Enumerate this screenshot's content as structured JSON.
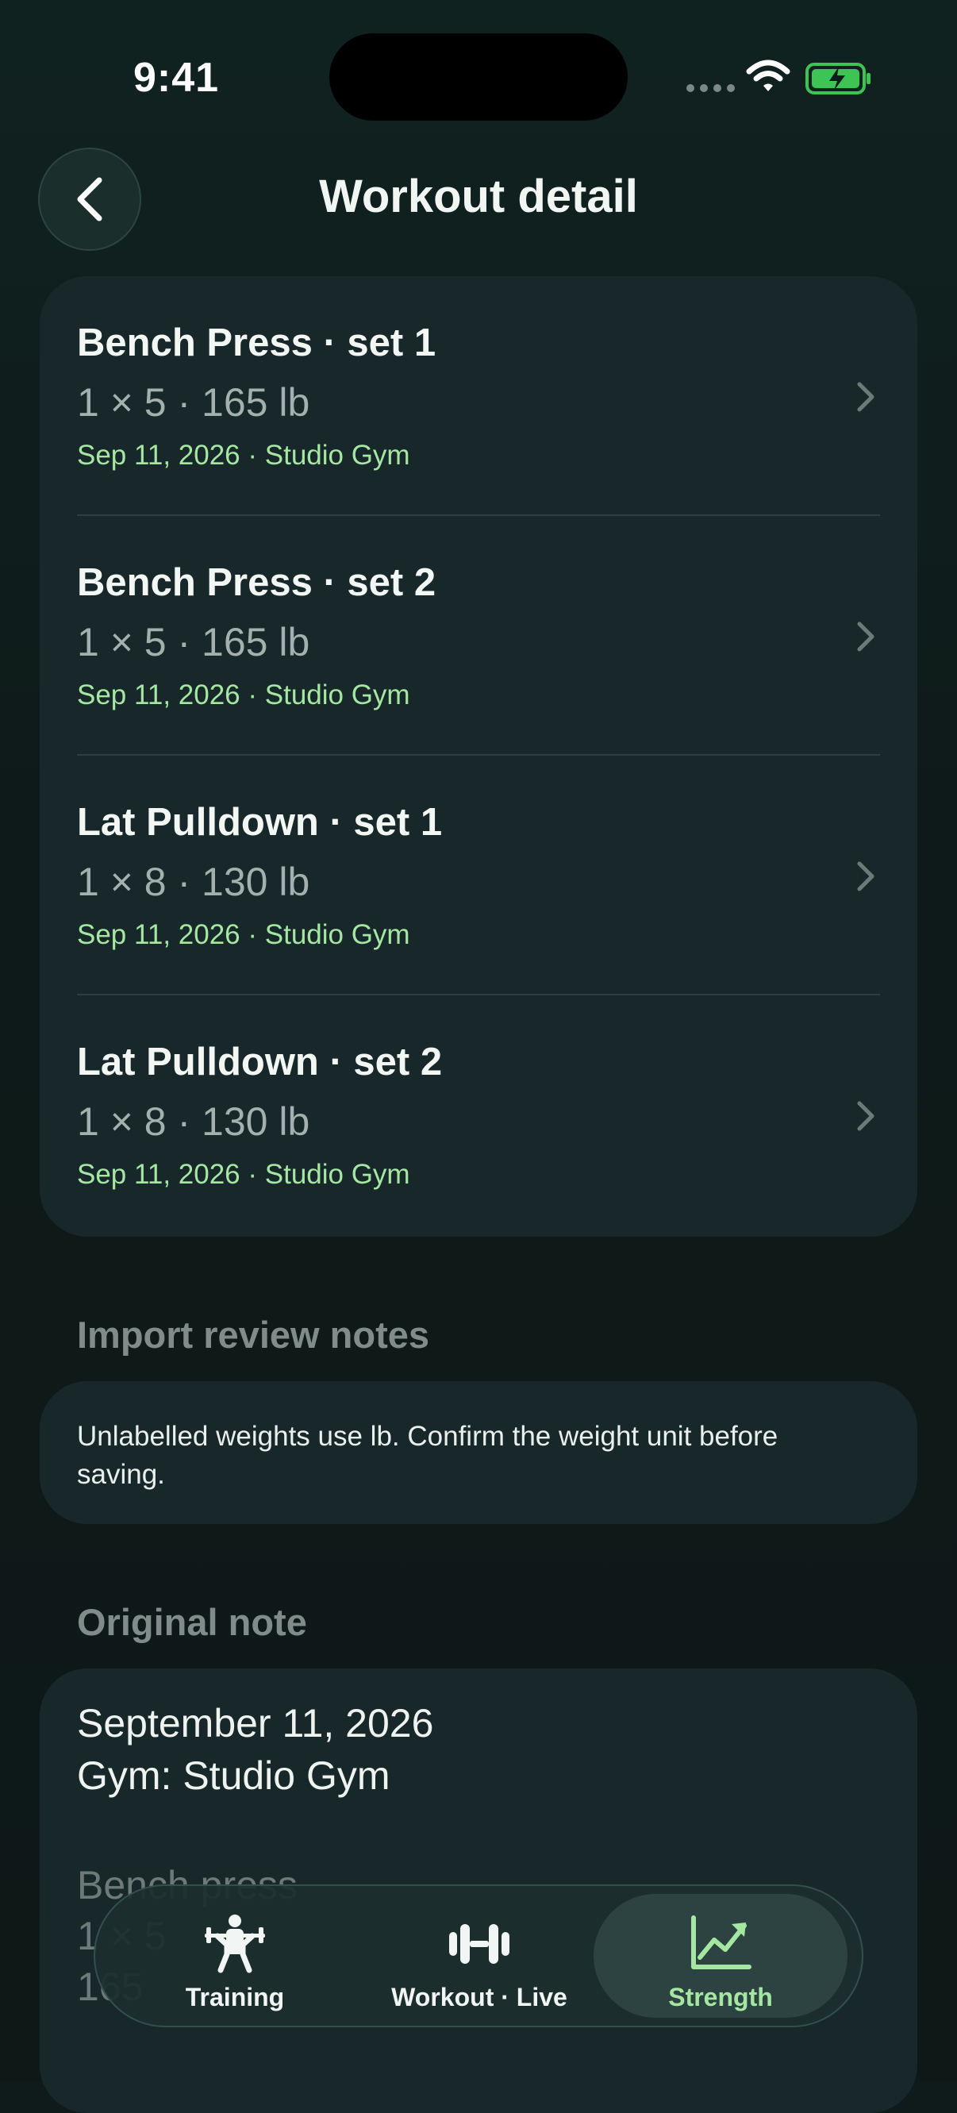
{
  "status_bar": {
    "time": "9:41"
  },
  "header": {
    "title": "Workout detail"
  },
  "sets": [
    {
      "name": "Bench Press · set 1",
      "detail": "1 × 5 · 165 lb",
      "meta": "Sep 11, 2026 · Studio Gym"
    },
    {
      "name": "Bench Press · set 2",
      "detail": "1 × 5 · 165 lb",
      "meta": "Sep 11, 2026 · Studio Gym"
    },
    {
      "name": "Lat Pulldown · set 1",
      "detail": "1 × 8 · 130 lb",
      "meta": "Sep 11, 2026 · Studio Gym"
    },
    {
      "name": "Lat Pulldown · set 2",
      "detail": "1 × 8 · 130 lb",
      "meta": "Sep 11, 2026 · Studio Gym"
    }
  ],
  "review_notes": {
    "title": "Import review notes",
    "text": "Unlabelled weights use lb. Confirm the weight unit before saving."
  },
  "original_note": {
    "title": "Original note",
    "lines": [
      "September 11, 2026",
      "Gym: Studio Gym",
      "Bench press",
      "1 × 5",
      "165"
    ]
  },
  "tabs": [
    {
      "label": "Training",
      "icon": "weightlifter-icon",
      "active": false
    },
    {
      "label": "Workout · Live",
      "icon": "dumbbell-icon",
      "active": false
    },
    {
      "label": "Strength",
      "icon": "trend-chart-icon",
      "active": true
    }
  ],
  "colors": {
    "background": "#0f1b1a",
    "card": "#18282a",
    "accent": "#a5e7a2",
    "muted": "#7f8c8a"
  }
}
